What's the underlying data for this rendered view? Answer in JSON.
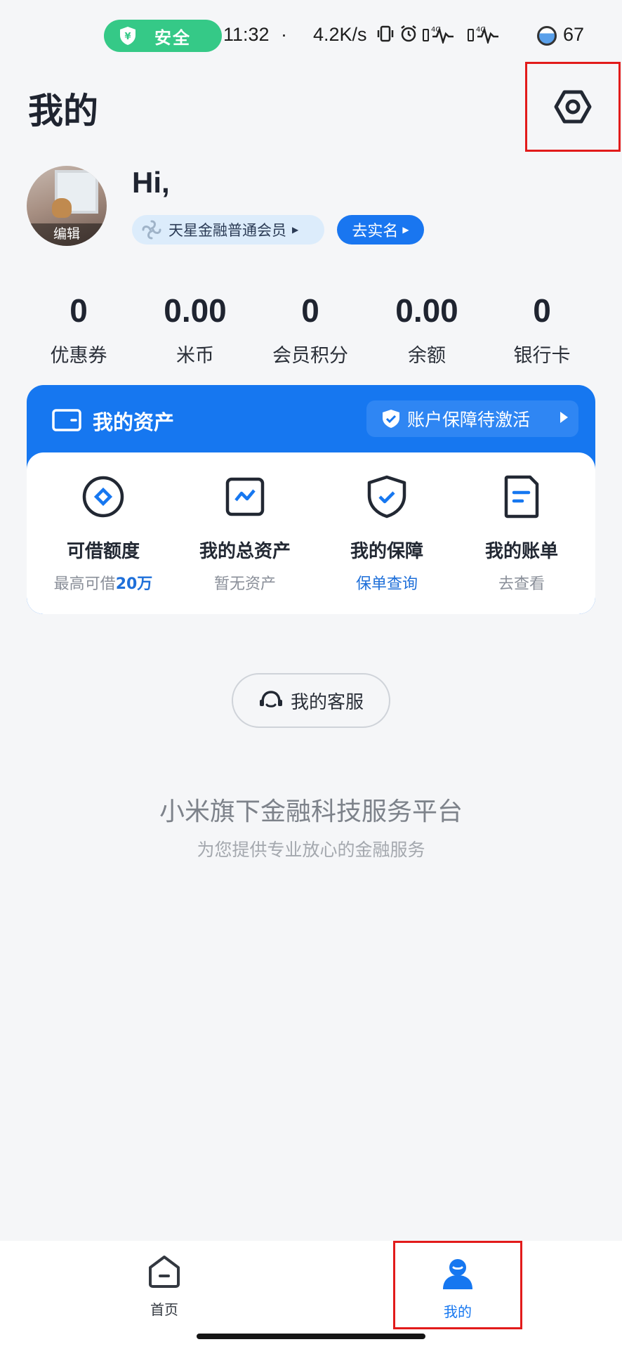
{
  "status_bar": {
    "safe_label": "安全",
    "time": "11:32",
    "dot": "·",
    "net_speed": "4.2K/s",
    "battery": "67",
    "icons": [
      "vibrate-icon",
      "alarm-icon",
      "signal-4g-icon",
      "signal-4g-icon"
    ]
  },
  "header": {
    "title": "我的",
    "settings_icon": "settings-hexagon-icon"
  },
  "profile": {
    "greeting": "Hi,",
    "avatar_edit": "编辑",
    "member_level": "天星金融普通会员",
    "verify_button": "去实名"
  },
  "stats": [
    {
      "value": "0",
      "label": "优惠券"
    },
    {
      "value": "0.00",
      "label": "米币"
    },
    {
      "value": "0",
      "label": "会员积分"
    },
    {
      "value": "0.00",
      "label": "余额"
    },
    {
      "value": "0",
      "label": "银行卡"
    }
  ],
  "assets": {
    "title": "我的资产",
    "protection_status": "账户保障待激活",
    "items": [
      {
        "icon": "loan-limit-icon",
        "name": "可借额度",
        "sub_prefix": "最高可借",
        "sub_highlight": "20万"
      },
      {
        "icon": "total-assets-chart-icon",
        "name": "我的总资产",
        "sub": "暂无资产"
      },
      {
        "icon": "insurance-shield-icon",
        "name": "我的保障",
        "sub": "保单查询"
      },
      {
        "icon": "bill-document-icon",
        "name": "我的账单",
        "sub": "去查看"
      }
    ]
  },
  "service": {
    "button": "我的客服"
  },
  "footer": {
    "platform_title": "小米旗下金融科技服务平台",
    "platform_sub": "为您提供专业放心的金融服务"
  },
  "bottom_nav": {
    "items": [
      {
        "label": "首页",
        "icon": "home-icon"
      },
      {
        "label": "我的",
        "icon": "user-icon"
      }
    ],
    "active": "我的"
  },
  "colors": {
    "primary": "#1677f0",
    "safe_green": "#35c987",
    "highlight_box": "#e21b1b",
    "background": "#f5f6f8"
  }
}
